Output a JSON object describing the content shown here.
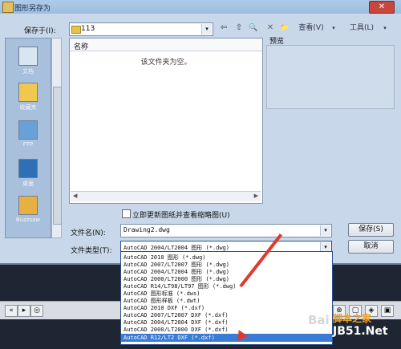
{
  "window": {
    "title": "图形另存为",
    "close": "✕"
  },
  "save_in": {
    "label": "保存于(I):",
    "value": "113"
  },
  "toolbar": {
    "back": "⇦",
    "up": "⇧",
    "search": "🔍",
    "delete": "✕",
    "new_folder": "📁",
    "views": "查看(V)",
    "tools": "工具(L)",
    "dropdown": "▾"
  },
  "places": [
    {
      "label": "文档",
      "color": "#d9e6f2"
    },
    {
      "label": "收藏夹",
      "color": "#f0c850"
    },
    {
      "label": "FTP",
      "color": "#6aa0d8"
    },
    {
      "label": "桌面",
      "color": "#2f6fb6"
    },
    {
      "label": "Buzzsaw",
      "color": "#e8b040"
    }
  ],
  "filelist": {
    "column_name": "名称",
    "empty_message": "该文件夹为空。"
  },
  "preview": {
    "label": "预览"
  },
  "update_thumbnail": {
    "label": "立即更新图纸并查看缩略图(U)"
  },
  "file_name": {
    "label": "文件名(N):",
    "value": "Drawing2.dwg"
  },
  "file_type": {
    "label": "文件类型(T):",
    "value": "AutoCAD 2004/LT2004 图形 (*.dwg)"
  },
  "buttons": {
    "save": "保存(S)",
    "cancel": "取消"
  },
  "file_type_options": [
    "AutoCAD 2010 图形 (*.dwg)",
    "AutoCAD 2007/LT2007 图形 (*.dwg)",
    "AutoCAD 2004/LT2004 图形 (*.dwg)",
    "AutoCAD 2000/LT2000 图形 (*.dwg)",
    "AutoCAD R14/LT98/LT97 图形 (*.dwg)",
    "AutoCAD 图形标准 (*.dws)",
    "AutoCAD 图形样板 (*.dwt)",
    "AutoCAD 2010 DXF (*.dxf)",
    "AutoCAD 2007/LT2007 DXF (*.dxf)",
    "AutoCAD 2004/LT2004 DXF (*.dxf)",
    "AutoCAD 2000/LT2000 DXF (*.dxf)",
    "AutoCAD R12/LT2 DXF (*.dxf)"
  ],
  "selected_option_index": 11,
  "watermark": {
    "site": "脚本之家",
    "domain": "JB51.Net",
    "prefix": "Bai"
  },
  "accent_colors": {
    "highlight": "#3a7bd5",
    "arrow": "#e03a2e"
  }
}
